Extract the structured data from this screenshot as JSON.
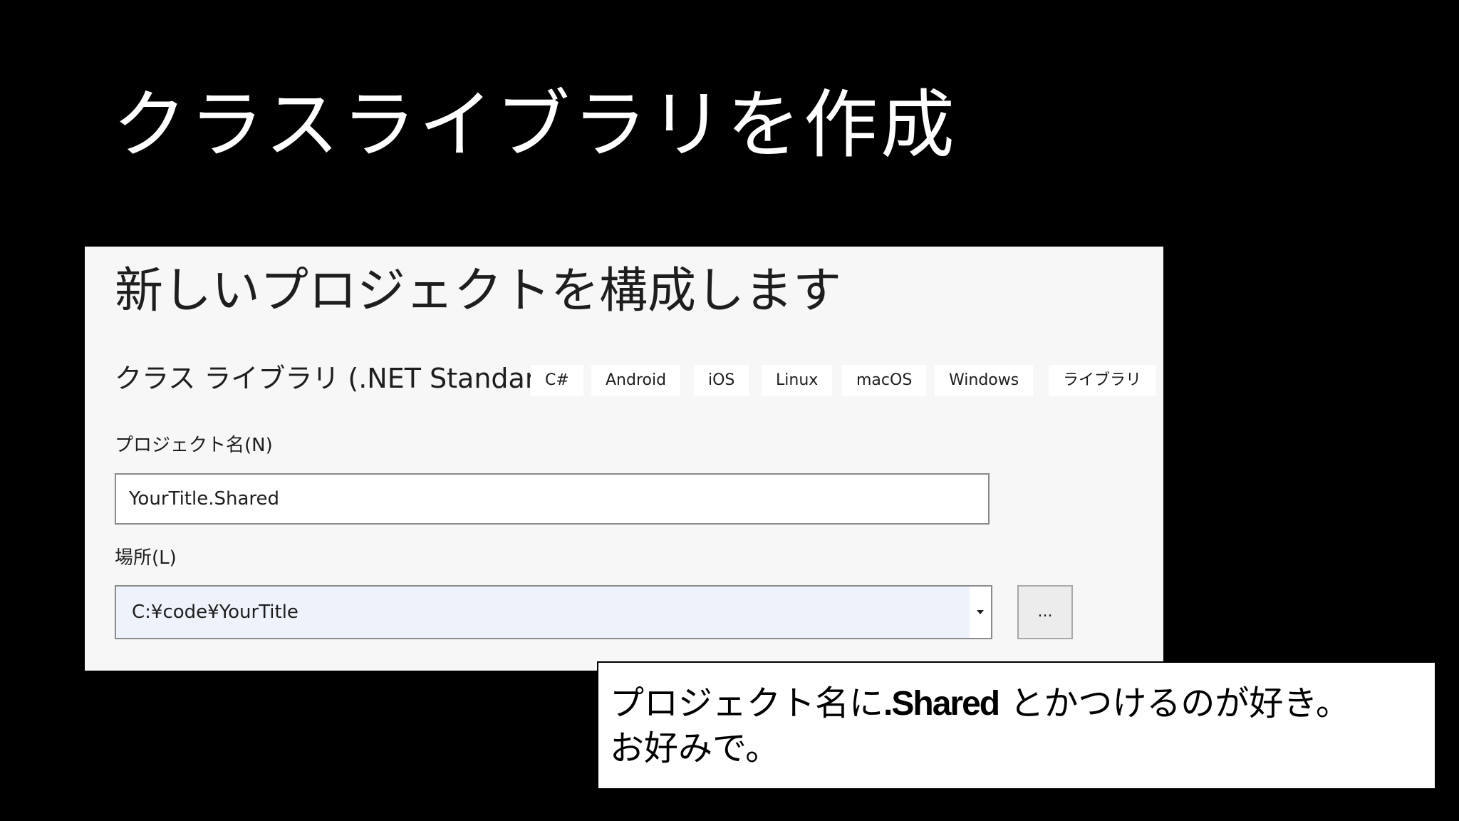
{
  "slide": {
    "title": "クラスライブラリを作成"
  },
  "dialog": {
    "heading": "新しいプロジェクトを構成します",
    "template_name": "クラス ライブラリ (.NET Standard)",
    "tags": [
      "C#",
      "Android",
      "iOS",
      "Linux",
      "macOS",
      "Windows",
      "ライブラリ"
    ],
    "project_name_label": "プロジェクト名(N)",
    "project_name_value": "YourTitle.Shared",
    "location_label": "場所(L)",
    "location_value": "C:¥code¥YourTitle",
    "browse_label": "..."
  },
  "callout": {
    "line1_prefix": "プロジェクト名に",
    "line1_emphasis": ".Shared",
    "line1_suffix": " とかつけるのが好き。",
    "line2": "お好みで。"
  },
  "colors": {
    "background": "#000000",
    "dialog_background": "#f7f7f8",
    "input_border": "#8a8a8a",
    "combo_background": "#eef3fb"
  }
}
